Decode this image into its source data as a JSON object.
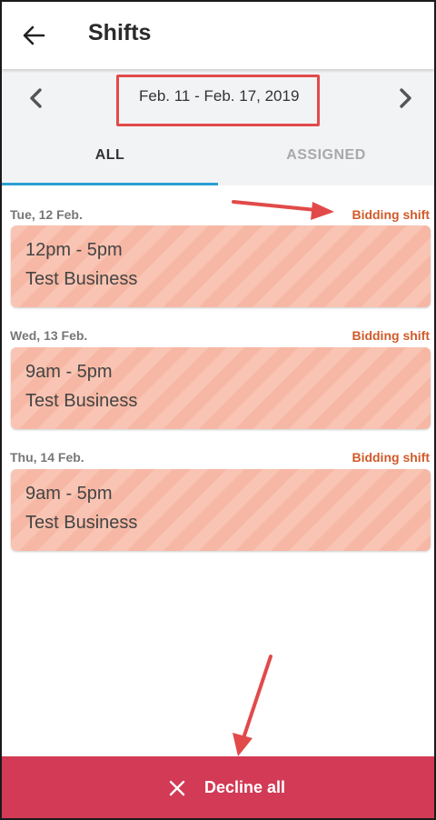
{
  "header": {
    "title": "Shifts",
    "back_icon": "arrow-left-icon"
  },
  "week": {
    "range": "Feb. 11 - Feb. 17, 2019",
    "prev_icon": "chevron-left-icon",
    "next_icon": "chevron-right-icon"
  },
  "tabs": {
    "all": "ALL",
    "assigned": "ASSIGNED",
    "active": "all"
  },
  "shifts": [
    {
      "day": "Tue, 12 Feb.",
      "status": "Bidding shift",
      "time": "12pm - 5pm",
      "business": "Test Business"
    },
    {
      "day": "Wed, 13 Feb.",
      "status": "Bidding shift",
      "time": "9am - 5pm",
      "business": "Test Business"
    },
    {
      "day": "Thu, 14 Feb.",
      "status": "Bidding shift",
      "time": "9am - 5pm",
      "business": "Test Business"
    }
  ],
  "footer": {
    "decline_label": "Decline all",
    "decline_icon": "close-icon"
  },
  "colors": {
    "accent_tab": "#2aa0d4",
    "bidding_status": "#d15a2a",
    "card_fill": "#f9c4b3",
    "decline_bg": "#d23a55",
    "annotation": "#e24a4a"
  }
}
